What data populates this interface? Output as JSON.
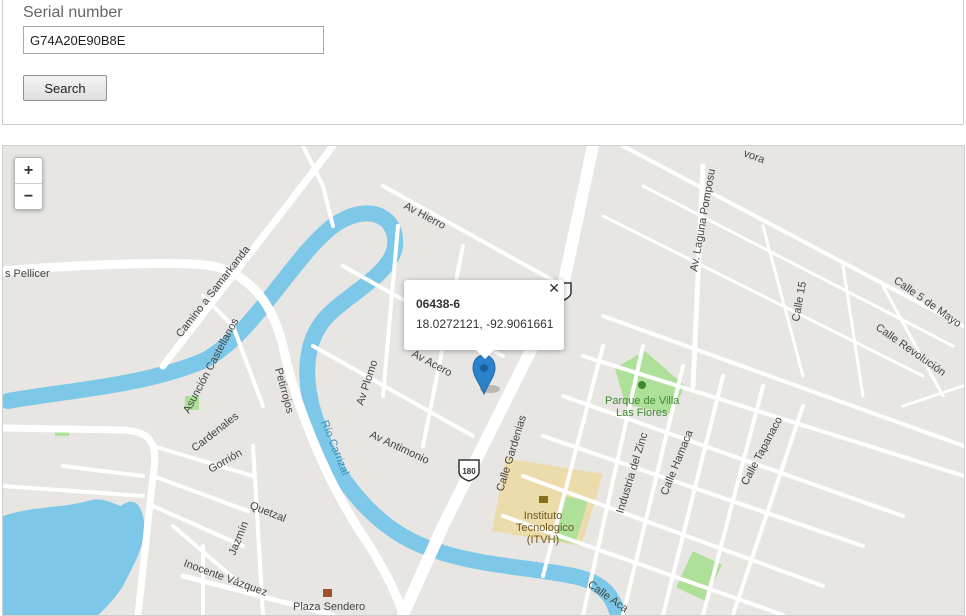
{
  "form": {
    "serial_label": "Serial number",
    "serial_value": "G74A20E90B8E",
    "search_label": "Search"
  },
  "map": {
    "zoom_in": "+",
    "zoom_out": "−",
    "popup": {
      "close": "✕",
      "id": "06438-6",
      "coords": "18.0272121, -92.9061661"
    },
    "labels": {
      "pellicer": "s Pellicer",
      "samarkanda": "Camino a Samarkanda",
      "hierro": "Av Hierro",
      "acero": "Av Acero",
      "plomo": "Av Plomo",
      "antimonio": "Av Antimonio",
      "rio": "Río Carrizal",
      "castellanos": "Asunción Castellanos",
      "petirrojos": "Petirrojos",
      "cardenales": "Cardenales",
      "gorrion": "Gorrión",
      "quetzal": "Quetzal",
      "jazmin": "Jazmín",
      "inocente": "Inocente Vázquez",
      "plaza": "Plaza Sendero",
      "laguna": "Av. Laguna Pomposu",
      "calle15": "Calle 15",
      "calle5mayo": "Calle 5 de Mayo",
      "revolucion": "Calle Revolución",
      "parque1": "Parque de Villa",
      "parque2": "Las Flores",
      "gardenias": "Calle Gardenias",
      "zinc": "Industria del Zinc",
      "hamaca": "Calle Hamaca",
      "tapanaco": "Calle Tapanaco",
      "instituto1": "Instituto",
      "instituto2": "Tecnologico",
      "instituto3": "(ITVH)",
      "aca": "Calle Aca",
      "vora": "vora",
      "highway": "180"
    }
  }
}
